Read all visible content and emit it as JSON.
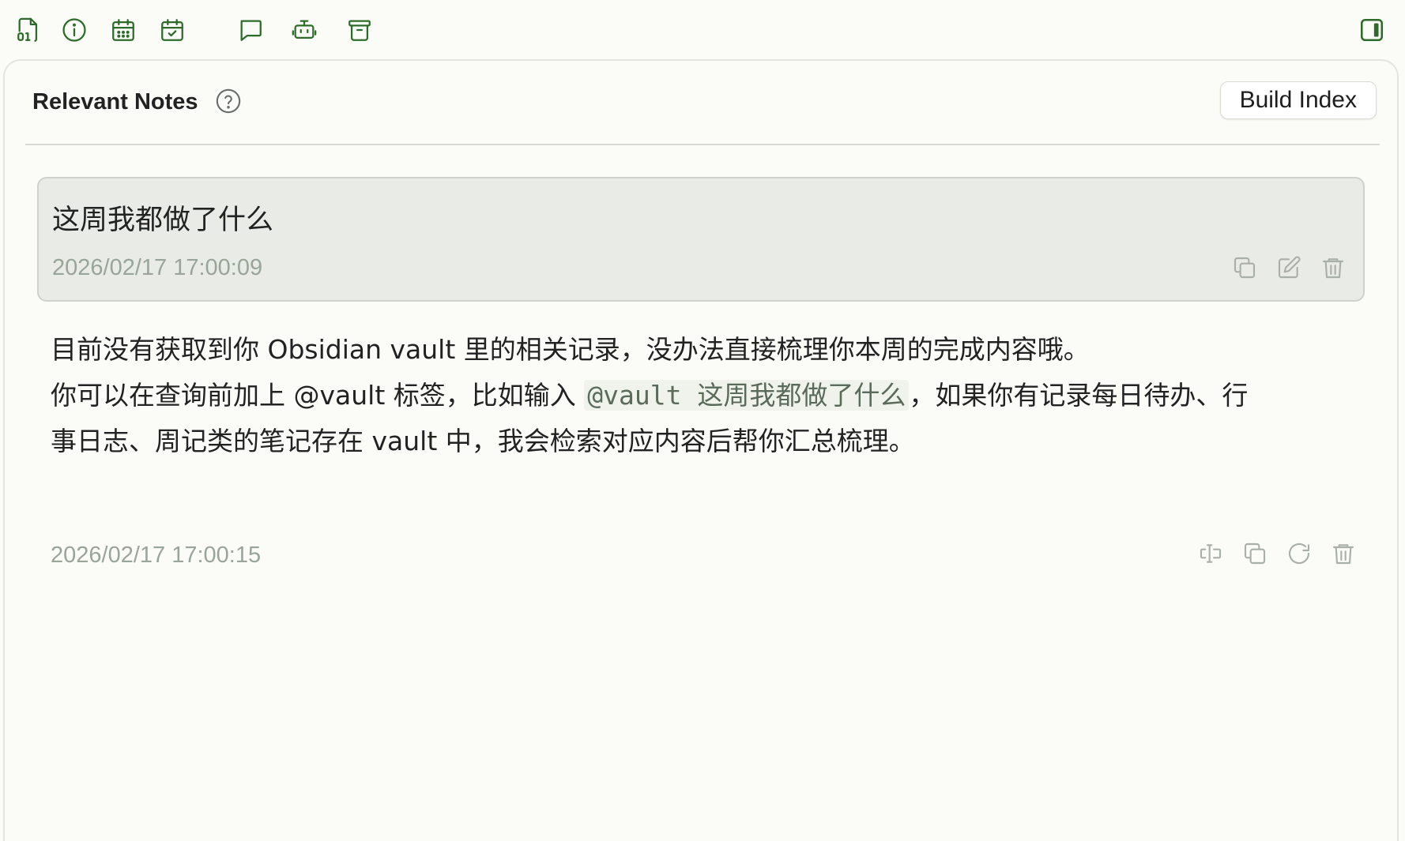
{
  "toolbar": {
    "icons": [
      {
        "name": "binary-file-icon"
      },
      {
        "name": "info-icon"
      },
      {
        "name": "calendar-icon"
      },
      {
        "name": "calendar-check-icon"
      },
      {
        "name": "chat-icon",
        "active": true
      },
      {
        "name": "robot-icon"
      },
      {
        "name": "archive-icon"
      }
    ],
    "right_icon": "sidebar-toggle-icon",
    "accent_color": "#2e6b2a"
  },
  "panel": {
    "title": "Relevant Notes",
    "help_icon": "question-circle-icon",
    "build_index_label": "Build Index"
  },
  "messages": {
    "user": {
      "text": "这周我都做了什么",
      "time": "2026/02/17 17:00:09",
      "actions": [
        "copy-icon",
        "edit-icon",
        "delete-icon"
      ]
    },
    "assistant": {
      "line1": "目前没有获取到你 Obsidian vault 里的相关记录，没办法直接梳理你本周的完成内容哦。",
      "line2_before": "你可以在查询前加上 @vault 标签，比如输入 ",
      "line2_code": "@vault 这周我都做了什么",
      "line2_after": "，如果你有记录每日待办、行",
      "line3": "事日志、周记类的笔记存在 vault 中，我会检索对应内容后帮你汇总梳理。",
      "time": "2026/02/17 17:00:15",
      "actions": [
        "insert-text-icon",
        "copy-icon",
        "regenerate-icon",
        "delete-icon"
      ]
    }
  }
}
